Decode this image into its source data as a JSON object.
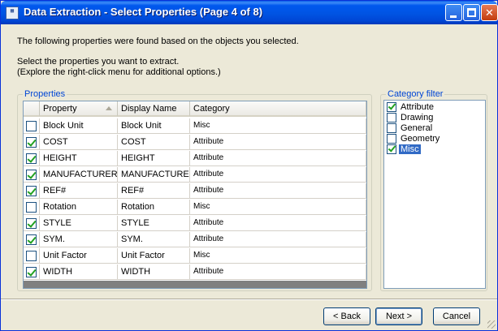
{
  "window": {
    "title": "Data Extraction - Select Properties (Page 4 of 8)",
    "icon": "data-extraction-app-icon"
  },
  "intro": {
    "line1": "The following properties were found based on the objects you selected.",
    "line2": "Select the properties you want to extract.",
    "line3": "(Explore the right-click menu for additional options.)"
  },
  "properties": {
    "group_label": "Properties",
    "columns": [
      "Property",
      "Display Name",
      "Category"
    ],
    "rows": [
      {
        "checked": false,
        "property": "Block Unit",
        "display": "Block Unit",
        "category": "Misc"
      },
      {
        "checked": true,
        "property": "COST",
        "display": "COST",
        "category": "Attribute"
      },
      {
        "checked": true,
        "property": "HEIGHT",
        "display": "HEIGHT",
        "category": "Attribute"
      },
      {
        "checked": true,
        "property": "MANUFACTURER",
        "display": "MANUFACTURER",
        "category": "Attribute"
      },
      {
        "checked": true,
        "property": "REF#",
        "display": "REF#",
        "category": "Attribute"
      },
      {
        "checked": false,
        "property": "Rotation",
        "display": "Rotation",
        "category": "Misc"
      },
      {
        "checked": true,
        "property": "STYLE",
        "display": "STYLE",
        "category": "Attribute"
      },
      {
        "checked": true,
        "property": "SYM.",
        "display": "SYM.",
        "category": "Attribute"
      },
      {
        "checked": false,
        "property": "Unit Factor",
        "display": "Unit Factor",
        "category": "Misc"
      },
      {
        "checked": true,
        "property": "WIDTH",
        "display": "WIDTH",
        "category": "Attribute"
      }
    ]
  },
  "category_filter": {
    "group_label": "Category filter",
    "items": [
      {
        "label": "Attribute",
        "checked": true,
        "selected": false
      },
      {
        "label": "Drawing",
        "checked": false,
        "selected": false
      },
      {
        "label": "General",
        "checked": false,
        "selected": false
      },
      {
        "label": "Geometry",
        "checked": false,
        "selected": false
      },
      {
        "label": "Misc",
        "checked": true,
        "selected": true
      }
    ]
  },
  "buttons": {
    "back": "< Back",
    "next": "Next >",
    "cancel": "Cancel"
  },
  "colors": {
    "title_bar": "#0054e3",
    "selection": "#316ac5",
    "group_label": "#0046d5",
    "check": "#21a121"
  }
}
